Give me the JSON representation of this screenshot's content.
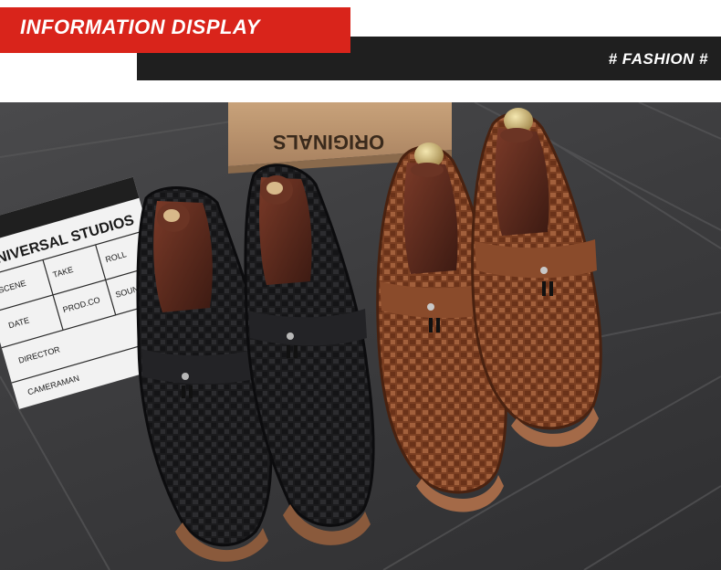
{
  "header": {
    "title": "INFORMATION DISPLAY",
    "tag": "# FASHION #"
  },
  "photo": {
    "box_text": "ORIGINALS",
    "clapper": {
      "studio": "UNIVERSAL STUDIOS",
      "labels": [
        "SCENE",
        "TAKE",
        "ROLL",
        "SOUND",
        "DATE",
        "PROD.CO",
        "DIRECTOR",
        "CAMERAMAN"
      ]
    },
    "colors": {
      "black_shoe": "#1b1b1d",
      "brown_shoe": "#8a4a2c",
      "tree_wood": "#5a2a1e",
      "accent_red": "#d9241b"
    }
  }
}
